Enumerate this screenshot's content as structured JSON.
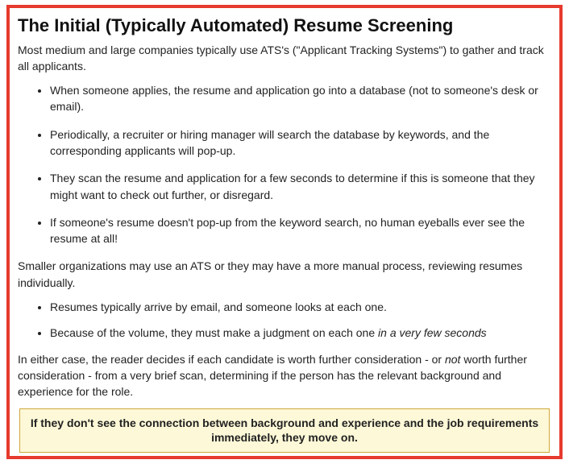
{
  "title": "The Initial (Typically Automated) Resume Screening",
  "intro": "Most medium and large companies typically use ATS's (\"Applicant Tracking Systems\") to gather and track all applicants.",
  "bullets1": [
    "When someone applies, the resume and application go into a database (not to someone's desk or email).",
    "Periodically, a recruiter or hiring manager will search the database by keywords, and the corresponding applicants will pop-up.",
    "They scan the resume and application for a few seconds to determine if this is someone that they might want to check out further, or disregard.",
    "If someone's resume doesn't pop-up from the keyword search, no human eyeballs ever see the resume at all!"
  ],
  "middle": "Smaller organizations may use an ATS or they may have a more manual process, reviewing resumes individually.",
  "bullets2": [
    {
      "prefix": "Resumes typically arrive by email, and someone looks at each one.",
      "italic": ""
    },
    {
      "prefix": "Because of the volume, they must make a judgment on each one ",
      "italic": "in a very few seconds"
    }
  ],
  "closing": {
    "p1": "In either case, the reader decides if each candidate is worth further consideration - or ",
    "p1_italic": "not",
    "p2": " worth further consideration - from a very brief scan, determining if the person has the relevant background and experience for the role."
  },
  "callout": "If they don't see the connection between background and experience and the job requirements immediately, they move on."
}
